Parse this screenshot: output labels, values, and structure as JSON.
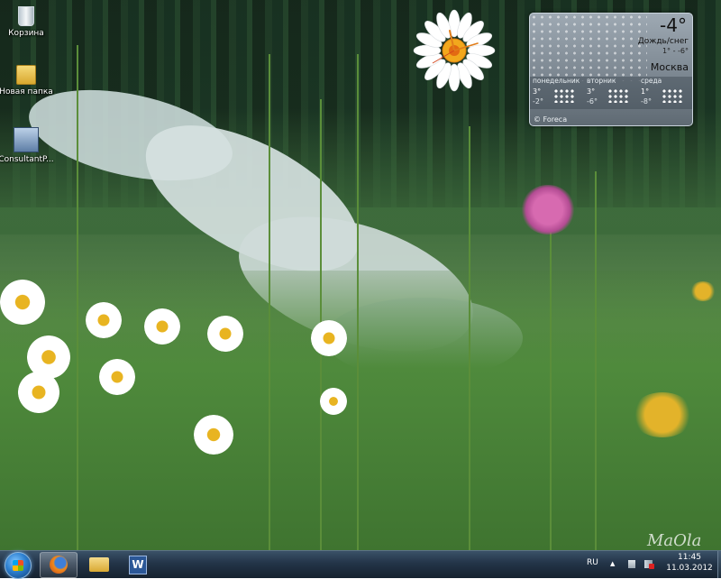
{
  "desktop_icons": [
    {
      "id": "recycle-bin",
      "label": "Корзина",
      "icon": "recycle-bin-icon"
    },
    {
      "id": "new-folder",
      "label": "Новая папка",
      "icon": "folder-icon"
    },
    {
      "id": "consultant",
      "label": "ConsultantP...",
      "icon": "consultant-plus-icon"
    }
  ],
  "weather": {
    "temperature": "-4°",
    "condition": "Дождь/снег",
    "range": "1° - -6°",
    "city": "Москва",
    "forecast": [
      {
        "day": "понедельник",
        "high": "3°",
        "low": "-2°"
      },
      {
        "day": "вторник",
        "high": "3°",
        "low": "-6°"
      },
      {
        "day": "среда",
        "high": "1°",
        "low": "-8°"
      }
    ],
    "provider": "© Foreca"
  },
  "watermark": "MaOla",
  "taskbar": {
    "apps": [
      {
        "name": "firefox",
        "active": true
      },
      {
        "name": "explorer",
        "active": false
      },
      {
        "name": "word",
        "active": false,
        "glyph": "W"
      }
    ],
    "language": "RU",
    "tray_up_arrow": "▲",
    "time": "11:45",
    "date": "11.03.2012"
  },
  "colors": {
    "taskbar_top": "#3a5167",
    "taskbar_bottom": "#16222f",
    "weather_panel": "#7c8791"
  }
}
